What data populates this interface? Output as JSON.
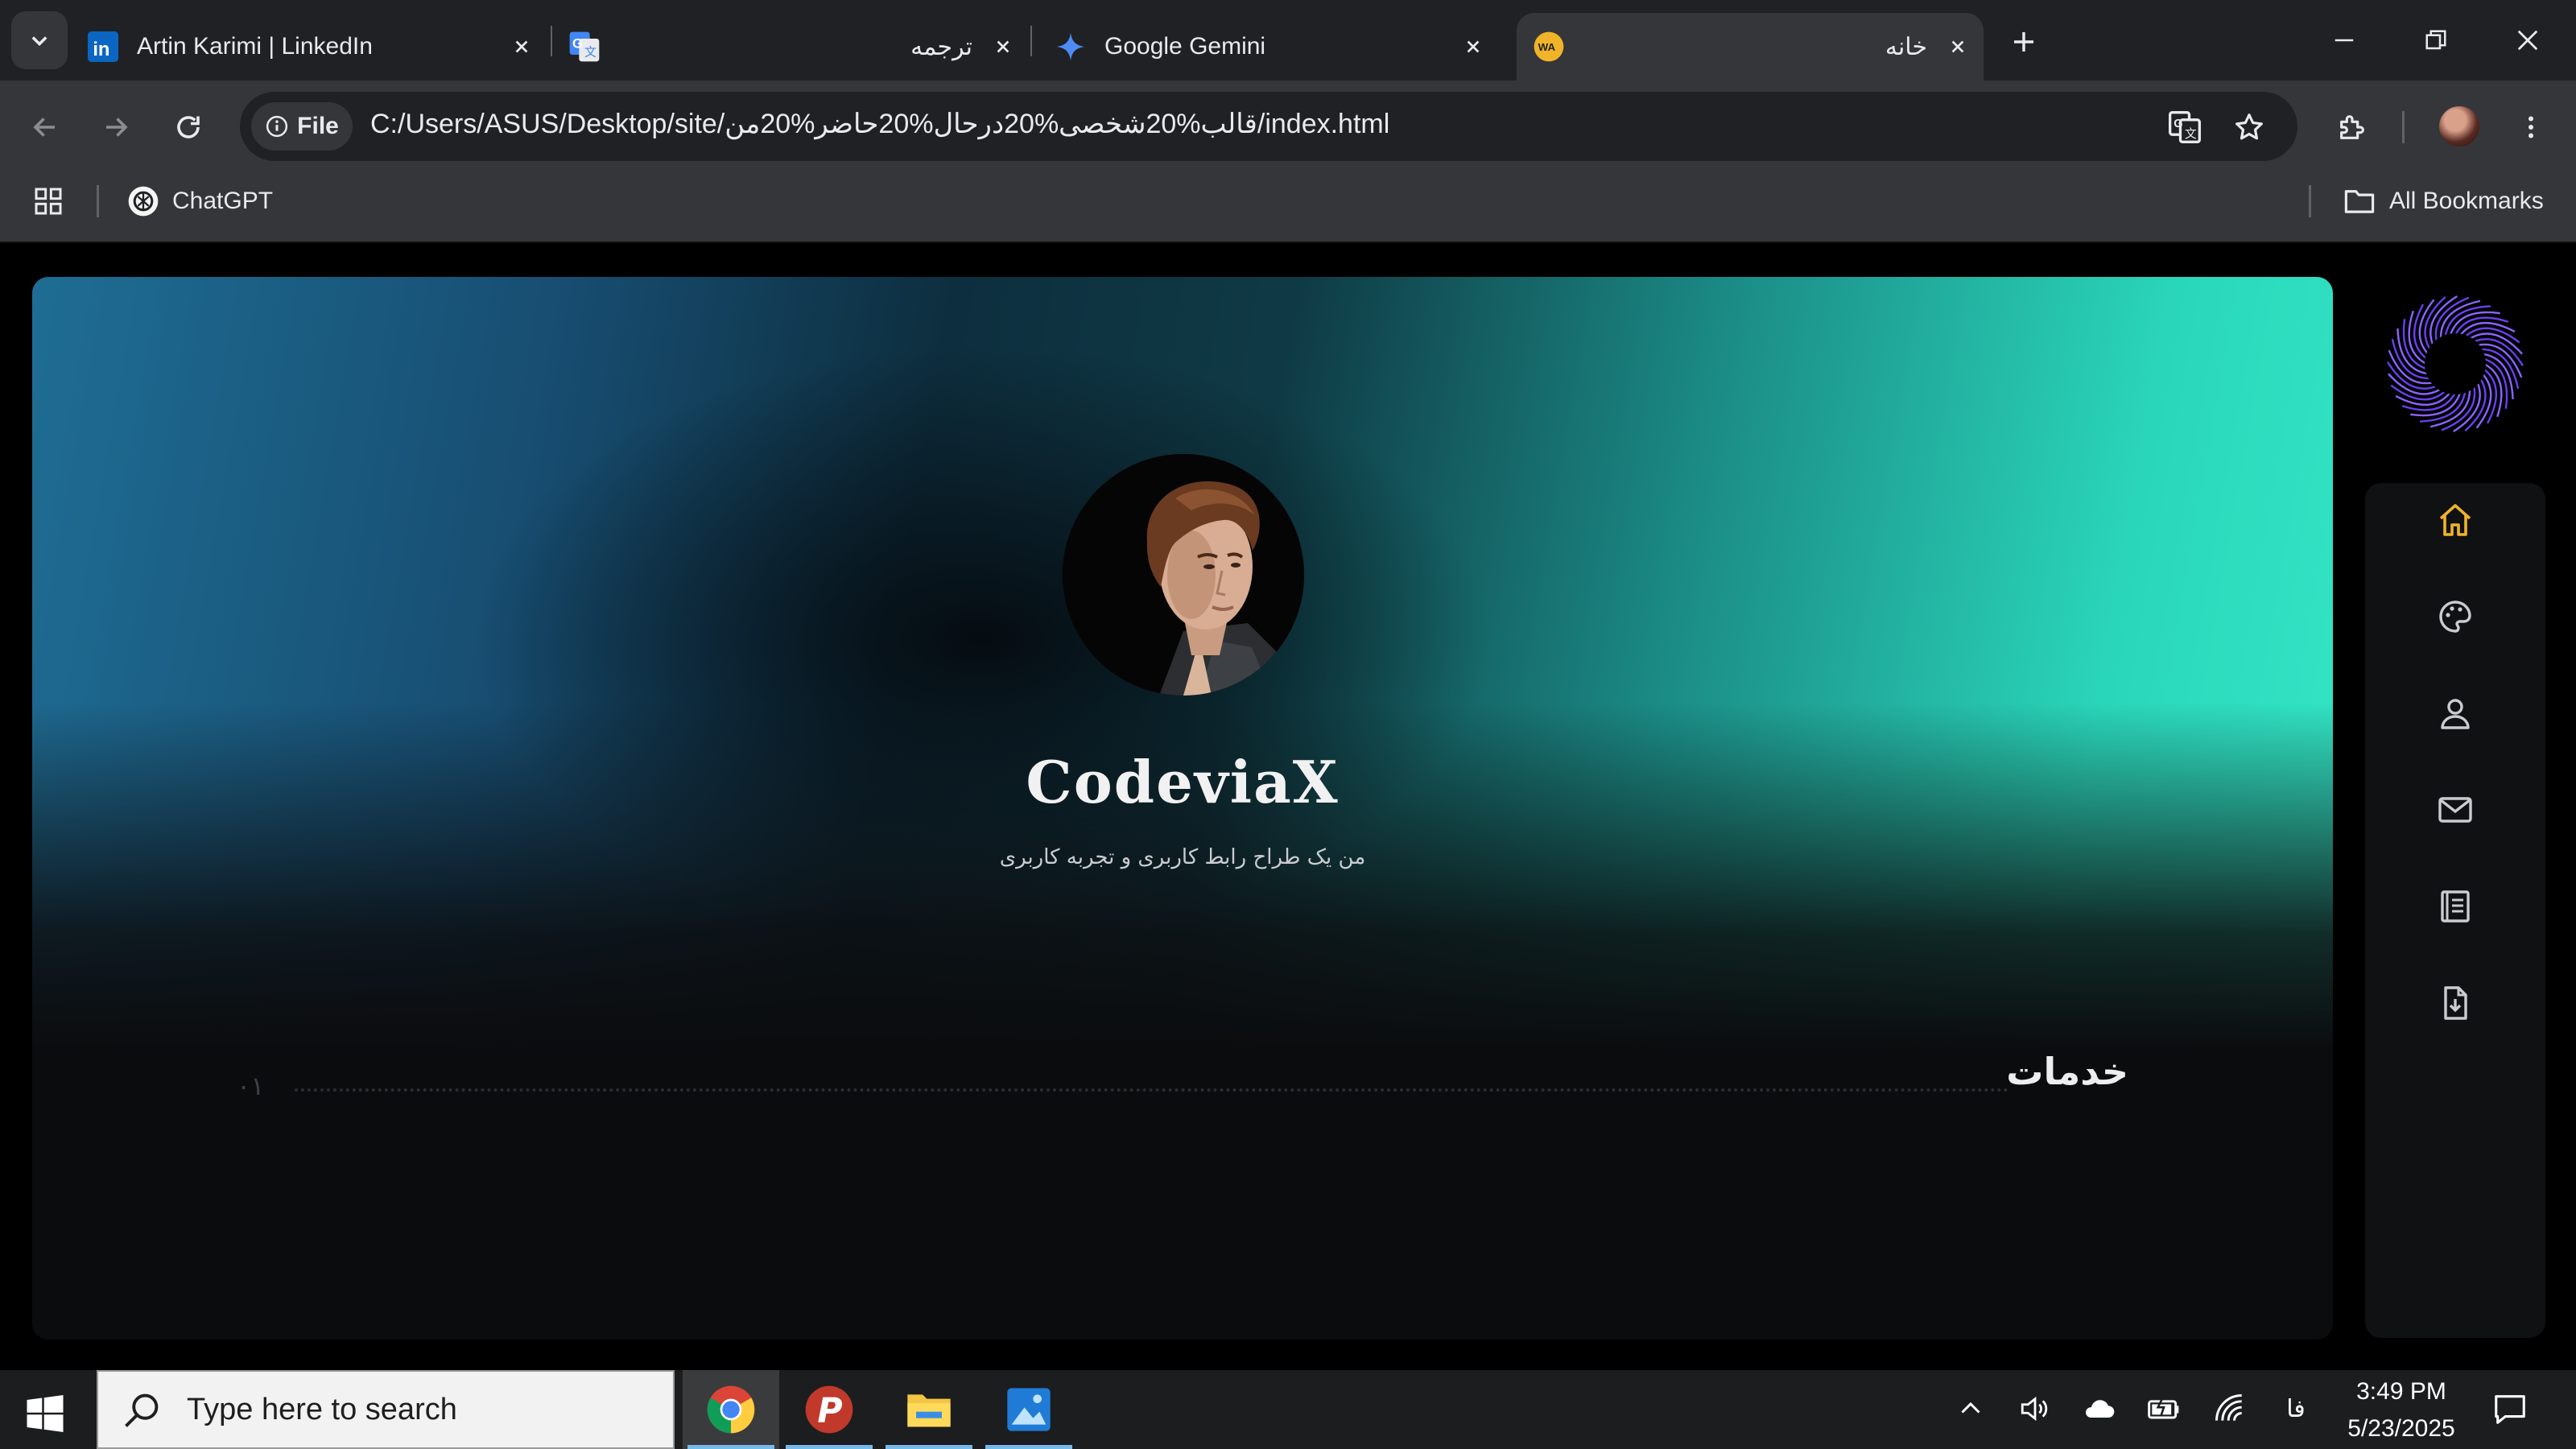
{
  "browser": {
    "tabs": [
      {
        "title": "Artin Karimi | LinkedIn",
        "favicon": "linkedin-icon"
      },
      {
        "title": "ترجمه",
        "favicon": "google-translate-icon"
      },
      {
        "title": "Google Gemini",
        "favicon": "gemini-icon"
      },
      {
        "title": "خانه",
        "favicon": "site-wa-icon",
        "active": true
      }
    ],
    "file_chip": "File",
    "url": "C:/Users/ASUS/Desktop/site/قالب%20شخصی%20درحال%20حاضر%20من/index.html",
    "bookmarks": [
      {
        "label": "ChatGPT",
        "icon": "chatgpt-icon"
      }
    ],
    "all_bookmarks": "All Bookmarks",
    "wa_badge": "WA"
  },
  "page": {
    "site_title": "CodeviaX",
    "subtitle": "من یک طراح رابط کاربری و تجربه کاربری",
    "section_title": "خدمات",
    "section_number": "۰۱",
    "side_nav": [
      "home-icon",
      "palette-icon",
      "user-icon",
      "mail-icon",
      "book-icon",
      "download-file-icon"
    ],
    "accent_color": "#f0b429"
  },
  "taskbar": {
    "search_placeholder": "Type here to search",
    "apps": [
      "chrome-icon",
      "psiphon-icon",
      "file-explorer-icon",
      "photos-icon"
    ],
    "language": "فا",
    "time": "3:49 PM",
    "date": "5/23/2025"
  }
}
